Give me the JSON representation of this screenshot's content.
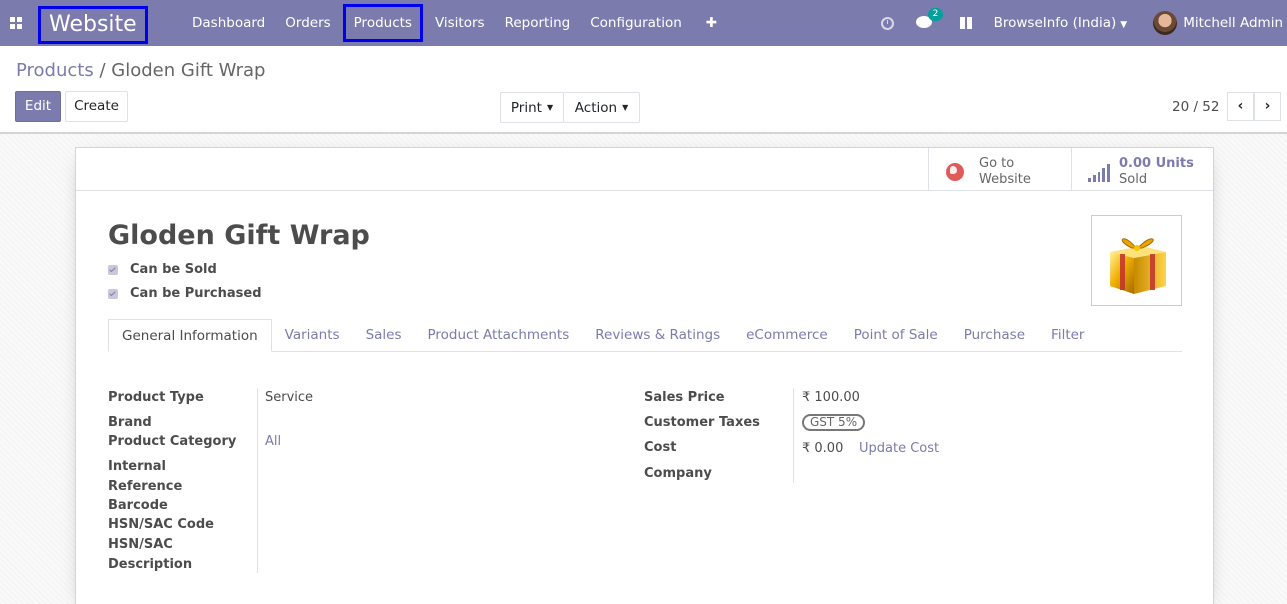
{
  "navbar": {
    "brand": "Website",
    "menu": [
      "Dashboard",
      "Orders",
      "Products",
      "Visitors",
      "Reporting",
      "Configuration"
    ],
    "plus": "✚",
    "chat_count": "2",
    "company": "BrowseInfo (India)",
    "user": "Mitchell Admin"
  },
  "breadcrumb": {
    "parent": "Products",
    "separator": "/",
    "current": "Gloden Gift Wrap"
  },
  "toolbar": {
    "edit": "Edit",
    "create": "Create",
    "print": "Print",
    "action": "Action"
  },
  "pager": {
    "value": "20 / 52",
    "prev": "‹",
    "next": "›"
  },
  "stat_buttons": {
    "website_line1": "Go to",
    "website_line2": "Website",
    "sold_value": "0.00 Units",
    "sold_label": "Sold"
  },
  "product": {
    "name": "Gloden Gift Wrap",
    "can_be_sold": "Can be Sold",
    "can_be_purchased": "Can be Purchased"
  },
  "tabs": [
    "General Information",
    "Variants",
    "Sales",
    "Product Attachments",
    "Reviews & Ratings",
    "eCommerce",
    "Point of Sale",
    "Purchase",
    "Filter"
  ],
  "fields_left": {
    "product_type_label": "Product Type",
    "product_type_value": "Service",
    "brand_label": "Brand",
    "category_label": "Product Category",
    "category_value": "All",
    "internal_ref_label_1": "Internal",
    "internal_ref_label_2": "Reference",
    "barcode_label": "Barcode",
    "hsn_code_label": "HSN/SAC Code",
    "hsn_desc_label_1": "HSN/SAC",
    "hsn_desc_label_2": "Description"
  },
  "fields_right": {
    "sales_price_label": "Sales Price",
    "sales_price_value": "₹ 100.00",
    "customer_taxes_label": "Customer Taxes",
    "customer_taxes_tag": "GST 5%",
    "cost_label": "Cost",
    "cost_value": "₹ 0.00",
    "update_cost": "Update Cost",
    "company_label": "Company"
  },
  "colors": {
    "primary": "#7c7bad",
    "highlight_box": "#0000ee"
  }
}
